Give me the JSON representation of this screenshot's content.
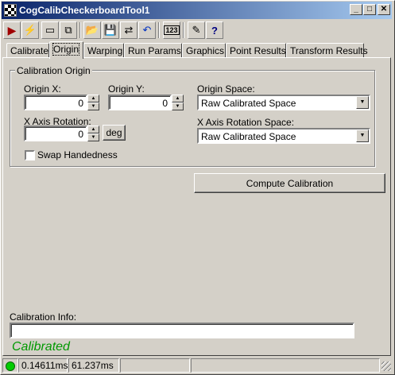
{
  "window": {
    "title": "CogCalibCheckerboardTool1"
  },
  "caption_buttons": {
    "minimize": "_",
    "maximize": "□",
    "close": "✕"
  },
  "toolbar": {
    "buttons": [
      {
        "icon": "run-icon"
      },
      {
        "icon": "electric-icon"
      },
      {
        "icon": "image-icon"
      },
      {
        "icon": "switch-icon"
      },
      {
        "icon": "open-icon"
      },
      {
        "icon": "save-icon"
      },
      {
        "icon": "image-swap-icon"
      },
      {
        "icon": "reset-icon"
      },
      {
        "icon": "numeric-icon",
        "label": "123"
      },
      {
        "icon": "edit-icon"
      },
      {
        "icon": "help-icon",
        "label": "?"
      }
    ]
  },
  "tabs": [
    {
      "label": "Calibrate"
    },
    {
      "label": "Origin",
      "active": true
    },
    {
      "label": "Warping"
    },
    {
      "label": "Run Params"
    },
    {
      "label": "Graphics"
    },
    {
      "label": "Point Results"
    },
    {
      "label": "Transform Results"
    }
  ],
  "group": {
    "title": "Calibration Origin",
    "origin_x": {
      "label": "Origin X:",
      "value": "0"
    },
    "origin_y": {
      "label": "Origin Y:",
      "value": "0"
    },
    "x_axis_rotation": {
      "label": "X Axis Rotation:",
      "value": "0",
      "unit_button": "deg"
    },
    "swap_handedness": {
      "label": "Swap Handedness",
      "checked": false
    },
    "origin_space": {
      "label": "Origin Space:",
      "value": "Raw Calibrated Space"
    },
    "rotation_space": {
      "label": "X Axis Rotation Space:",
      "value": "Raw Calibrated Space"
    }
  },
  "compute_button": "Compute Calibration",
  "calibration_info": {
    "label": "Calibration Info:",
    "value": ""
  },
  "status": {
    "text": "Calibrated",
    "color": "#009900"
  },
  "statusbar": {
    "indicator_color": "#00cc00",
    "time1": "0.14611ms",
    "time2": "61.237ms"
  }
}
